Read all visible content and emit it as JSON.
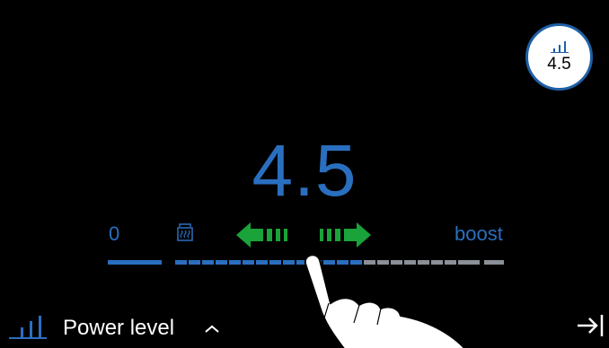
{
  "power_badge": {
    "icon": "power-bars-icon",
    "value": "4.5"
  },
  "power_display": {
    "value": "4.5"
  },
  "scale": {
    "min_label": "0",
    "max_label": "boost",
    "level_fraction": 0.5
  },
  "controls": {
    "decrease_icon": "arrow-left-icon",
    "increase_icon": "arrow-right-icon",
    "keep_warm_icon": "pot-icon"
  },
  "footer": {
    "label": "Power level",
    "icon": "power-bars-icon",
    "expand_icon": "chevron-up-icon",
    "exit_icon": "exit-icon"
  },
  "colors": {
    "accent": "#2a6fbf",
    "arrow": "#1aa33a",
    "inactive": "#8a9096"
  }
}
